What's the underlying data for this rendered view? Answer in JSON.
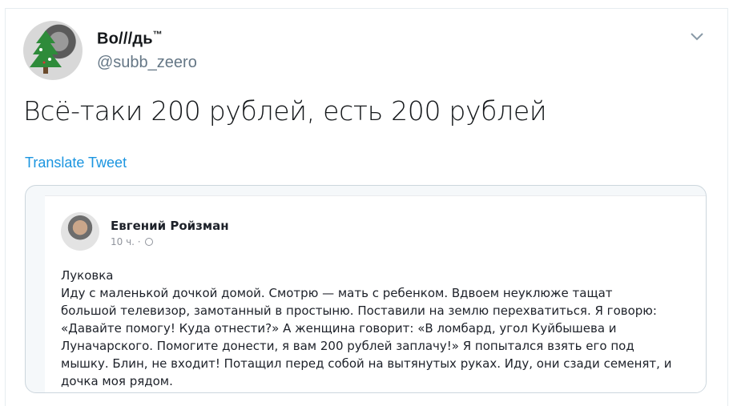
{
  "author": {
    "display_name": "Во///дь",
    "trademark": "™",
    "handle": "@subb_zeero"
  },
  "tweet": {
    "text": "Всё-таки 200 рублей, есть 200 рублей",
    "translate_label": "Translate Tweet"
  },
  "embedded_post": {
    "author": "Евгений Ройзман",
    "time": "10 ч. ·",
    "body": "Луковка\nИду с маленькой дочкой домой. Смотрю — мать с ребенком. Вдвоем неуклюже тащат\nбольшой телевизор, замотанный в простыню. Поставили на землю перехватиться. Я говорю:\n«Давайте помогу! Куда отнести?» А женщина говорит: «В ломбард, угол Куйбышева и\nЛуначарского. Помогите донести, я вам 200 рублей заплачу!» Я попытался взять его под\nмышку. Блин, не входит! Потащил перед собой на вытянутых руках. Иду, они сзади семенят, и\nдочка моя рядом."
  },
  "colors": {
    "link": "#1b95e0",
    "secondary_text": "#657786",
    "border": "#ccd6dd"
  },
  "icons": {
    "caret": "chevron-down-icon",
    "privacy": "globe-icon"
  }
}
